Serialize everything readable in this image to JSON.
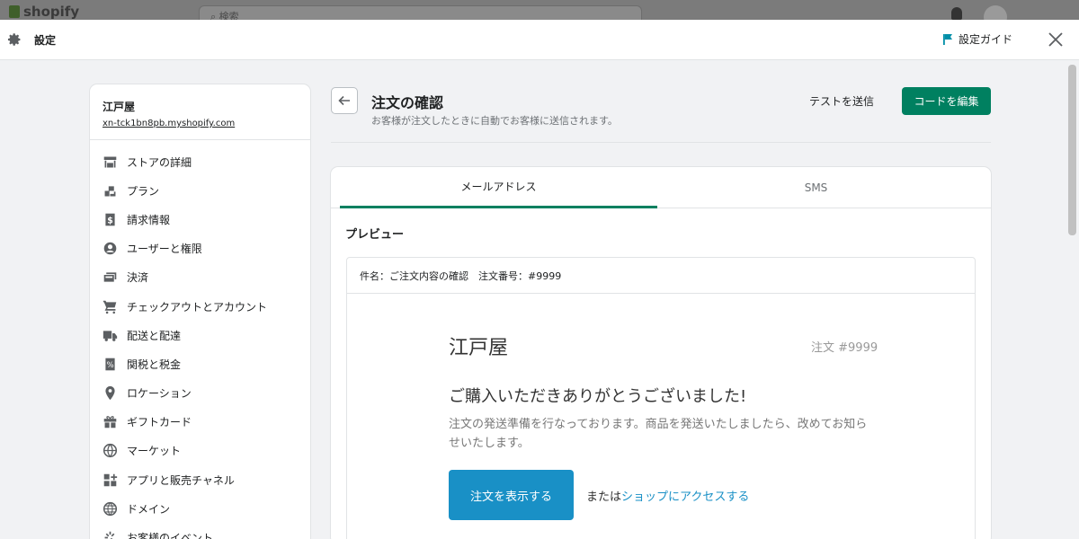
{
  "background": {
    "logo_text": "shopify",
    "search_placeholder": "検索"
  },
  "topbar": {
    "title": "設定",
    "guide_label": "設定ガイド"
  },
  "sidebar": {
    "store_name": "江戸屋",
    "store_url": "xn-tck1bn8pb.myshopify.com",
    "items": [
      {
        "label": "ストアの詳細",
        "icon": "store-icon"
      },
      {
        "label": "プラン",
        "icon": "plan-icon"
      },
      {
        "label": "請求情報",
        "icon": "billing-icon"
      },
      {
        "label": "ユーザーと権限",
        "icon": "user-icon"
      },
      {
        "label": "決済",
        "icon": "payment-icon"
      },
      {
        "label": "チェックアウトとアカウント",
        "icon": "cart-icon"
      },
      {
        "label": "配送と配達",
        "icon": "truck-icon"
      },
      {
        "label": "関税と税金",
        "icon": "tax-icon"
      },
      {
        "label": "ロケーション",
        "icon": "location-pin-icon"
      },
      {
        "label": "ギフトカード",
        "icon": "gift-icon"
      },
      {
        "label": "マーケット",
        "icon": "globe-icon"
      },
      {
        "label": "アプリと販売チャネル",
        "icon": "apps-icon"
      },
      {
        "label": "ドメイン",
        "icon": "domain-globe-icon"
      },
      {
        "label": "お客様のイベント",
        "icon": "customer-events-icon"
      }
    ]
  },
  "main": {
    "title": "注文の確認",
    "subtitle": "お客様が注文したときに自動でお客様に送信されます。",
    "test_button": "テストを送信",
    "edit_button": "コードを編集",
    "tabs": [
      {
        "label": "メールアドレス",
        "active": true
      },
      {
        "label": "SMS",
        "active": false
      }
    ],
    "preview_label": "プレビュー",
    "email": {
      "subject": "件名：ご注文内容の確認　注文番号：#9999",
      "store_name": "江戸屋",
      "order_number": "注文 #9999",
      "thanks": "ご購入いただきありがとうございました!",
      "description": "注文の発送準備を行なっております。商品を発送いたしましたら、改めてお知らせいたします。",
      "view_order_button": "注文を表示する",
      "or_text": "または",
      "shop_link": "ショップにアクセスする"
    }
  },
  "colors": {
    "primary": "#008060",
    "email_accent": "#1990c6",
    "guide_flag": "#008fa8"
  }
}
